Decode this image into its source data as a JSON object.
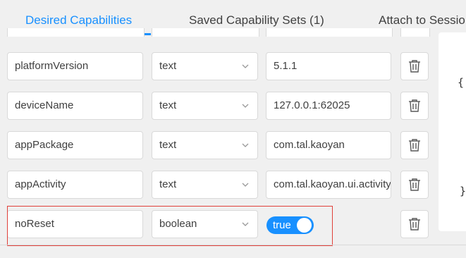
{
  "tabs": [
    {
      "label": "Desired Capabilities",
      "active": true
    },
    {
      "label": "Saved Capability Sets (1)",
      "active": false
    },
    {
      "label": "Attach to Session",
      "active": false
    }
  ],
  "capabilities": [
    {
      "name": "platformVersion",
      "type": "text",
      "value": "5.1.1"
    },
    {
      "name": "deviceName",
      "type": "text",
      "value": "127.0.0.1:62025"
    },
    {
      "name": "appPackage",
      "type": "text",
      "value": "com.tal.kaoyan"
    },
    {
      "name": "appActivity",
      "type": "text",
      "value": "com.tal.kaoyan.ui.activity"
    },
    {
      "name": "noReset",
      "type": "boolean",
      "value": "true",
      "toggle_on": true
    }
  ],
  "json_preview": {
    "open_brace": "{",
    "close_brace": "}"
  },
  "icons": {
    "select_arrow": "chevron-down-icon",
    "delete": "trash-icon"
  },
  "colors": {
    "accent": "#1890ff",
    "highlight_border": "#e0403a"
  }
}
